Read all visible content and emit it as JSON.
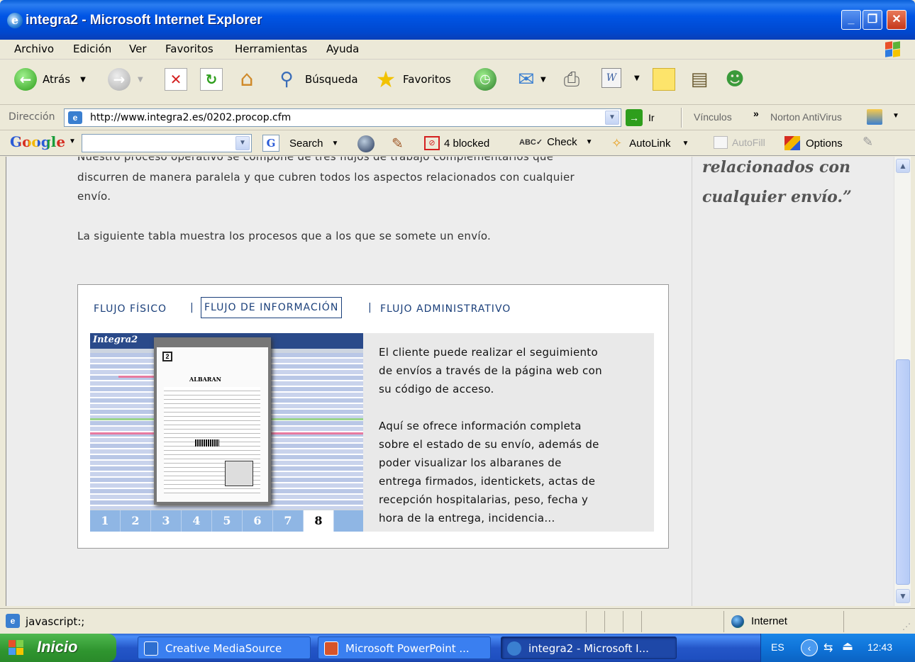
{
  "window": {
    "title": "integra2 - Microsoft Internet Explorer"
  },
  "menu": [
    "Archivo",
    "Edición",
    "Ver",
    "Favoritos",
    "Herramientas",
    "Ayuda"
  ],
  "toolbar": {
    "back": "Atrás",
    "search": "Búsqueda",
    "favorites": "Favoritos"
  },
  "address": {
    "label": "Dirección",
    "url": "http://www.integra2.es/0202.procop.cfm",
    "go": "Ir",
    "links": "Vínculos",
    "norton": "Norton AntiVirus"
  },
  "google": {
    "logo": "Google",
    "search": "Search",
    "blocked": "4 blocked",
    "check": "Check",
    "autolink": "AutoLink",
    "autofill": "AutoFill",
    "options": "Options"
  },
  "content": {
    "intro_cut": "Nuestro proceso operativo se compone de tres flujos de trabajo complementarios que",
    "intro_1": "discurren de manera paralela y que cubren todos los aspectos relacionados con cualquier",
    "intro_2": "envío.",
    "table_intro": "La siguiente tabla muestra los procesos que a los que se somete un envío.",
    "quote_1": "relacionados con",
    "quote_2": "cualquier envío.”"
  },
  "tabs": [
    "FLUJO FÍSICO",
    "FLUJO DE INFORMACIÓN",
    "FLUJO ADMINISTRATIVO"
  ],
  "panel": {
    "p1_l1": "El cliente puede realizar el seguimiento",
    "p1_l2": "de envíos a través de la página web con",
    "p1_l3": "su código de acceso.",
    "p2_l1": "Aquí se ofrece información completa",
    "p2_l2": "sobre el estado de su envío, además de",
    "p2_l3": "poder visualizar los albaranes de",
    "p2_l4": "entrega firmados, identickets, actas de",
    "p2_l5": "recepción hospitalarias, peso, fecha y",
    "p2_l6": "hora de la entrega, incidencia..."
  },
  "image": {
    "logo": "Integra2",
    "doc_title": "ALBARAN"
  },
  "pager": [
    "1",
    "2",
    "3",
    "4",
    "5",
    "6",
    "7",
    "8"
  ],
  "status": {
    "text": "javascript:;",
    "zone": "Internet"
  },
  "taskbar": {
    "start": "Inicio",
    "tasks": [
      "Creative MediaSource",
      "Microsoft PowerPoint ...",
      "integra2 - Microsoft I..."
    ],
    "lang": "ES",
    "time": "12:43"
  }
}
